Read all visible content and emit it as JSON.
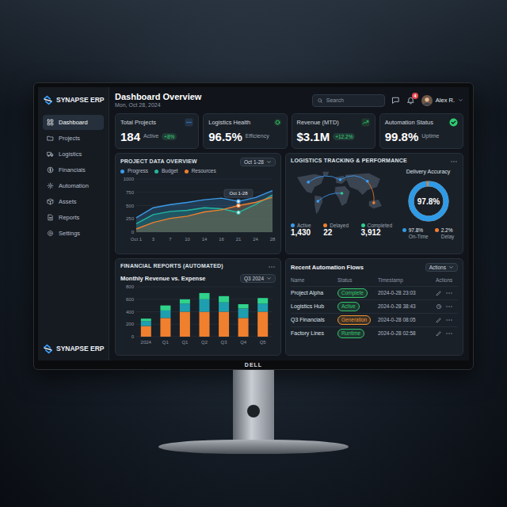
{
  "monitor": {
    "brand": "DELL"
  },
  "sidebar": {
    "logo": "SYNAPSE ERP",
    "items": [
      {
        "label": "Dashboard",
        "selected": true
      },
      {
        "label": "Projects",
        "selected": false
      },
      {
        "label": "Logistics",
        "selected": false
      },
      {
        "label": "Financials",
        "selected": false
      },
      {
        "label": "Automation",
        "selected": false
      },
      {
        "label": "Assets",
        "selected": false
      },
      {
        "label": "Reports",
        "selected": false
      },
      {
        "label": "Settings",
        "selected": false
      }
    ],
    "footer_logo": "SYNAPSE ERP"
  },
  "header": {
    "title": "Dashboard Overview",
    "date": "Mon, Oct 28, 2024",
    "search": {
      "placeholder": "Search"
    },
    "notification_count": "4",
    "user": "Alex R."
  },
  "kpis": [
    {
      "title": "Total Projects",
      "value": "184",
      "caption": "Active",
      "delta": "+8%",
      "color": "#3b8fe0"
    },
    {
      "title": "Logistics Health",
      "value": "96.5%",
      "caption": "Efficiency",
      "color": "#2ecc71"
    },
    {
      "title": "Revenue (MTD)",
      "value": "$3.1M",
      "delta": "+12.2%",
      "color": "#2ecc71"
    },
    {
      "title": "Automation Status",
      "value": "99.8%",
      "caption": "Uptime",
      "color": "#2ecc71"
    }
  ],
  "project_chart": {
    "title": "PROJECT DATA OVERVIEW",
    "range": "Oct 1-28",
    "series": [
      {
        "name": "Progress",
        "color": "#3b9be8",
        "values": [
          270,
          460,
          520,
          560,
          610,
          640,
          580,
          650,
          780
        ]
      },
      {
        "name": "Budget",
        "color": "#22b8a0",
        "values": [
          160,
          330,
          390,
          410,
          460,
          440,
          370,
          520,
          700
        ]
      },
      {
        "name": "Resources",
        "color": "#f07f2e",
        "values": [
          60,
          180,
          260,
          300,
          380,
          420,
          500,
          560,
          660
        ]
      }
    ],
    "y_ticks": [
      "1000",
      "750",
      "500",
      "250",
      "0"
    ],
    "x_ticks": [
      "Oct 1",
      "3",
      "7",
      "10",
      "14",
      "16",
      "21",
      "24",
      "28"
    ],
    "tooltip": {
      "label": "Oct 1-28",
      "point": 6
    }
  },
  "logistics": {
    "title": "LOGISTICS TRACKING & PERFORMANCE",
    "stats": [
      {
        "label": "Active",
        "value": "1,430",
        "color": "#3b9be8"
      },
      {
        "label": "Delayed",
        "value": "22",
        "color": "#f07f2e"
      },
      {
        "label": "Completed",
        "value": "3,912",
        "color": "#2ecc8f"
      }
    ],
    "accuracy": {
      "title": "Delivery Accuracy",
      "value": "97.8%",
      "level": 0.978,
      "legend": [
        {
          "value": "97.8%",
          "label": "On-Time",
          "color": "#2f9be6"
        },
        {
          "value": "2.2%",
          "label": "Delay",
          "color": "#f07f2e"
        }
      ]
    }
  },
  "finance": {
    "title": "FINANCIAL REPORTS (AUTOMATED)",
    "subtitle": "Monthly Revenue vs. Expense",
    "period": "Q3 2024",
    "y_ticks": [
      "800",
      "600",
      "400",
      "200",
      "0"
    ],
    "x_ticks": [
      "2024",
      "Q1",
      "Q1",
      "Q2",
      "Q3",
      "Q4",
      "Q5"
    ],
    "series": [
      {
        "color": "#f07f2e",
        "values": [
          170,
          300,
          400,
          400,
          400,
          300,
          400
        ]
      },
      {
        "color": "#1e9fb0",
        "values": [
          80,
          120,
          130,
          200,
          150,
          150,
          130
        ]
      },
      {
        "color": "#2fd38a",
        "values": [
          40,
          80,
          70,
          100,
          100,
          70,
          90
        ]
      }
    ]
  },
  "automation": {
    "title": "Recent Automation Flows",
    "menu": "Actions",
    "columns": [
      "Name",
      "Status",
      "Timestamp",
      "Actions"
    ],
    "rows": [
      {
        "name": "Project Alpha",
        "status": "Complete",
        "color": "#35c46a",
        "timestamp": "2024-0-28 23:03",
        "kind": "edit"
      },
      {
        "name": "Logistics Hub",
        "status": "Active",
        "color": "#35c46a",
        "timestamp": "2024-0-28 38:43",
        "kind": "schedule"
      },
      {
        "name": "Q3 Financials",
        "status": "Generation",
        "color": "#f0932e",
        "timestamp": "2024-0-28 08:05",
        "kind": "edit"
      },
      {
        "name": "Factory Lines",
        "status": "Runtime",
        "color": "#35c46a",
        "timestamp": "2024-0-28 02:58",
        "kind": "edit"
      }
    ]
  }
}
